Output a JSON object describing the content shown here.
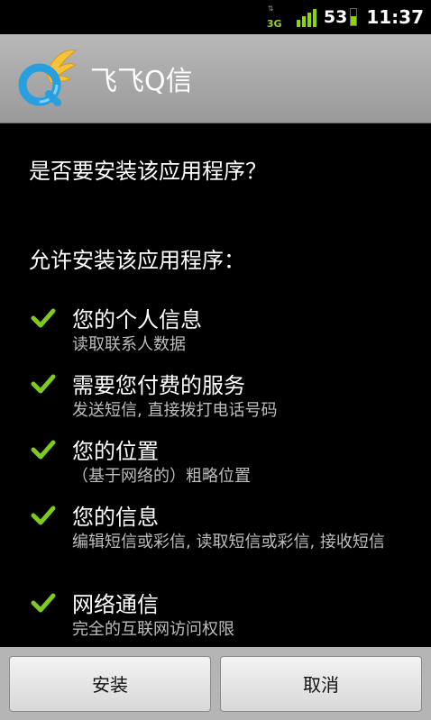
{
  "status_bar": {
    "network_label": "3G",
    "battery_percent_text": "53",
    "battery_level": 0.53,
    "time": "11:37",
    "accent_color": "#8fd400"
  },
  "app": {
    "title": "飞飞Q信",
    "icon": "feifei-q-logo-icon"
  },
  "dialog": {
    "question": "是否要安装该应用程序？",
    "allow_heading": "允许安装该应用程序：",
    "permissions": [
      {
        "title": "您的个人信息",
        "desc": "读取联系人数据"
      },
      {
        "title": "需要您付费的服务",
        "desc": "发送短信, 直接拨打电话号码"
      },
      {
        "title": "您的位置",
        "desc": "（基于网络的）粗略位置"
      },
      {
        "title": "您的信息",
        "desc": "编辑短信或彩信, 读取短信或彩信, 接收短信"
      },
      {
        "title": "网络通信",
        "desc": "完全的互联网访问权限"
      }
    ],
    "check_color": "#7ecb20"
  },
  "buttons": {
    "install": "安装",
    "cancel": "取消"
  }
}
